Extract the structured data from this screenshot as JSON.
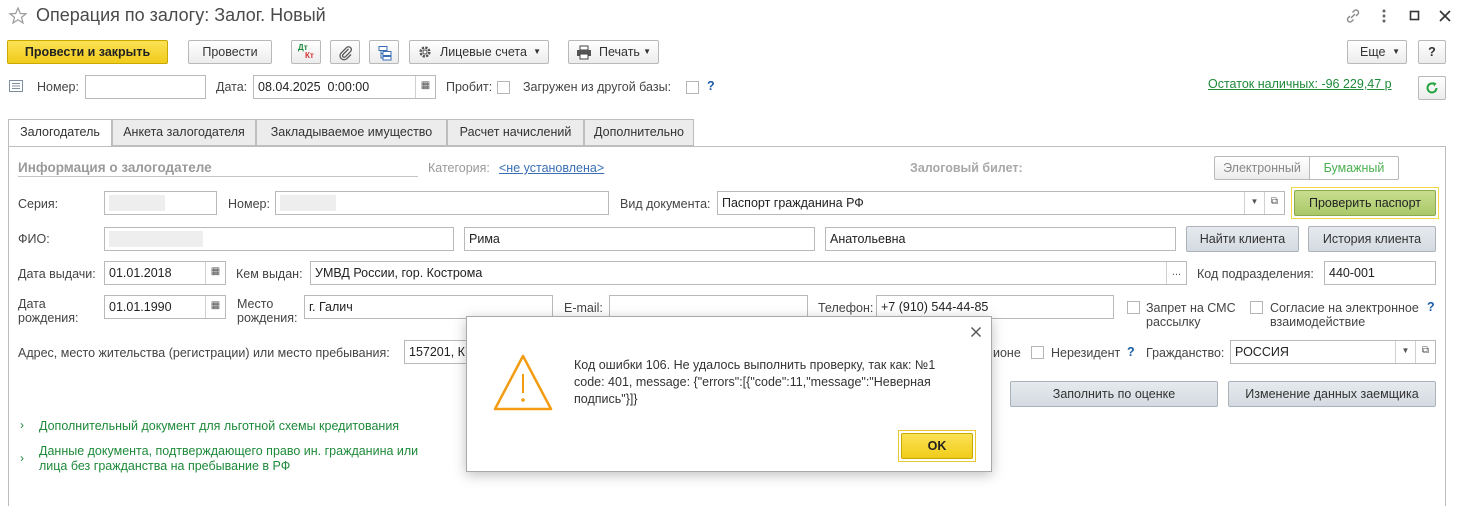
{
  "window": {
    "title": "Операция по залогу: Залог. Новый"
  },
  "toolbar": {
    "post_close": "Провести и закрыть",
    "post": "Провести",
    "dtkt_top": "Дт",
    "dtkt_bottom": "Кт",
    "accounts": "Лицевые счета",
    "print": "Печать",
    "more": "Еще",
    "help": "?"
  },
  "header": {
    "number_label": "Номер:",
    "number_value": "",
    "date_label": "Дата:",
    "date_value": "08.04.2025  0:00:00",
    "punched_label": "Пробит:",
    "loaded_label": "Загружен из другой базы:",
    "question": "?",
    "cash_balance": "Остаток наличных: -96 229,47 р"
  },
  "tabs": [
    {
      "label": "Залогодатель",
      "active": true
    },
    {
      "label": "Анкета залогодателя",
      "active": false
    },
    {
      "label": "Закладываемое имущество",
      "active": false
    },
    {
      "label": "Расчет начислений",
      "active": false
    },
    {
      "label": "Дополнительно",
      "active": false
    }
  ],
  "pledger": {
    "section_title": "Информация о залогодателе",
    "category_label": "Категория:",
    "category_value": "<не установлена>",
    "ticket_label": "Залоговый билет:",
    "ticket_electronic": "Электронный",
    "ticket_paper": "Бумажный",
    "series_label": "Серия:",
    "number_label": "Номер:",
    "doc_type_label": "Вид документа:",
    "doc_type_value": "Паспорт гражданина РФ",
    "check_passport": "Проверить паспорт",
    "fio_label": "ФИО:",
    "first_name": "Рима",
    "patronymic": "Анатольевна",
    "find_client": "Найти клиента",
    "client_history": "История клиента",
    "issue_date_label": "Дата выдачи:",
    "issue_date": "01.01.2018",
    "issued_by_label": "Кем выдан:",
    "issued_by": "УМВД России, гор. Кострома",
    "ellipsis": "...",
    "dept_code_label": "Код подразделения:",
    "dept_code": "440-001",
    "birth_date_label": "Дата рождения:",
    "birth_date": "01.01.1990",
    "birth_place_label": "Место рождения:",
    "birth_place": "г. Галич",
    "email_label": "E-mail:",
    "email": "",
    "phone_label": "Телефон:",
    "phone": "+7 (910) 544-44-85",
    "sms_ban": "Запрет на СМС рассылку",
    "e_consent": "Согласие на электронное взаимодействие",
    "address_label": "Адрес, место жительства (регистрации) или место пребывания:",
    "address": "157201, К",
    "region_tail": "ионе",
    "non_resident": "Нерезидент",
    "citizenship_label": "Гражданство:",
    "citizenship": "РОССИЯ",
    "fill_by_estimate": "Заполнить по оценке",
    "change_borrower": "Изменение данных заемщика",
    "extra_doc_link": "Дополнительный документ для льготной схемы кредитования",
    "foreign_doc_link": "Данные документа, подтверждающего право ин. гражданина или лица без гражданства на пребывание в РФ"
  },
  "dialog": {
    "message": "Код ошибки 106. Не удалось выполнить проверку, так как: №1 code: 401, message: {\"errors\":[{\"code\":11,\"message\":\"Неверная подпись\"}]}",
    "ok": "OK"
  },
  "colors": {
    "primary_button": "#f5d327",
    "check_passport": "#b6d27a",
    "link_green": "#1e8a3a",
    "warning_orange": "#f39c12"
  }
}
